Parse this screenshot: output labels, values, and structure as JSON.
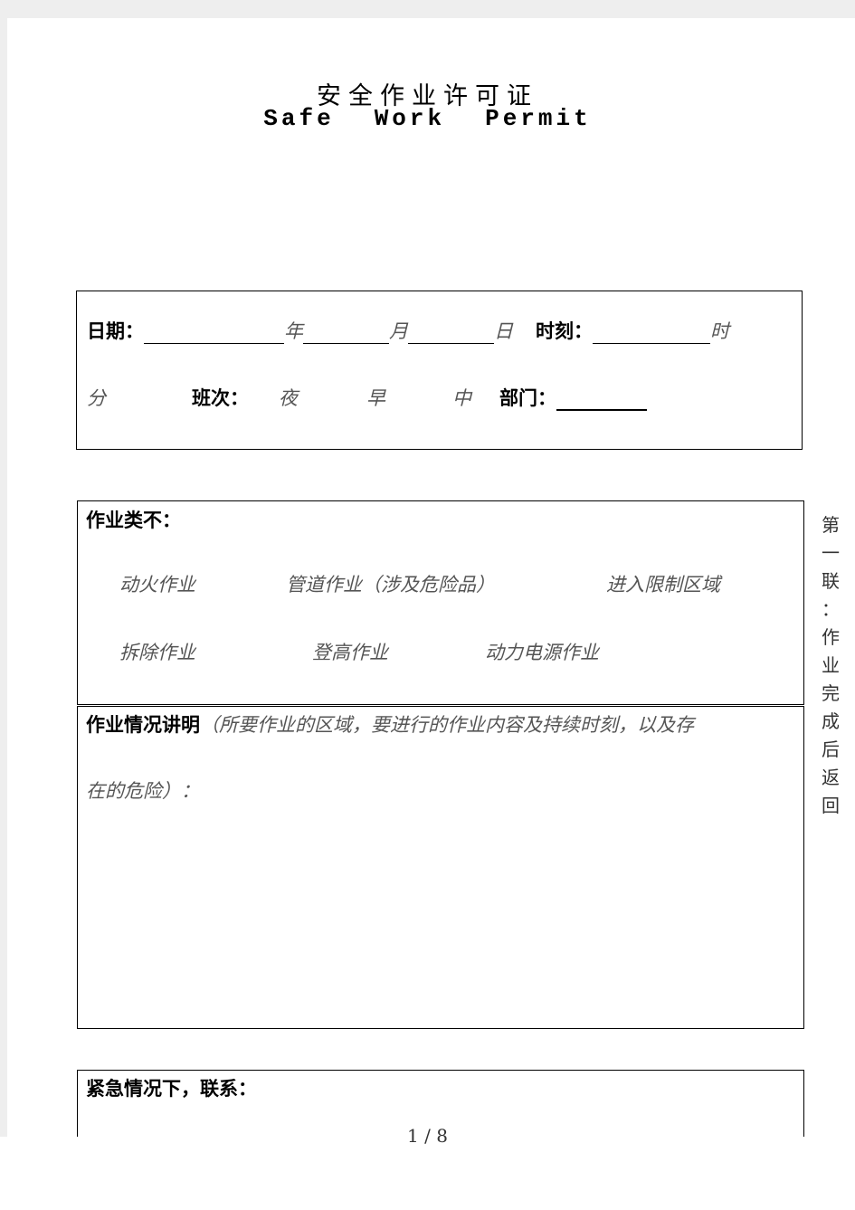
{
  "title_cn": "安全作业许可证",
  "title_en": [
    "Safe",
    "Work",
    "Permit"
  ],
  "date_box": {
    "date_label": "日期：",
    "year": "年",
    "month": "月",
    "day": "日",
    "time_label": "时刻：",
    "hour": "时",
    "minute": "分",
    "shift_label": "班次：",
    "shifts": [
      "夜",
      "早",
      "中"
    ],
    "dept_label": "部门："
  },
  "type_box": {
    "label": "作业类不：",
    "row1": [
      "动火作业",
      "管道作业（涉及危险品）",
      "进入限制区域"
    ],
    "row2": [
      "拆除作业",
      "登高作业",
      "动力电源作业"
    ]
  },
  "desc_box": {
    "label": "作业情况讲明",
    "hint1": "（所要作业的区域，要进行的作业内容及持续时刻，以及存",
    "hint2": "在的危险）："
  },
  "emergency": {
    "label": "紧急情况下，联系："
  },
  "side_note": [
    "第",
    "一",
    "联",
    "：",
    "作",
    "业",
    "完",
    "成",
    "后",
    "返",
    "回"
  ],
  "page_number": "1 / 8"
}
